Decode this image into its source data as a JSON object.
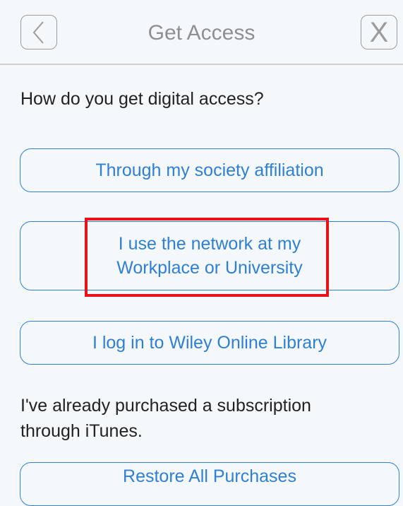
{
  "header": {
    "title": "Get Access",
    "back_icon": "chevron-left-icon",
    "close_label": "X"
  },
  "prompt": "How do you get digital access?",
  "options": {
    "society": "Through my society affiliation",
    "network_line1": "I use the network at my",
    "network_line2": "Workplace or University",
    "wiley": "I log in to Wiley Online Library"
  },
  "purchased_note": {
    "line1": "I've already purchased a subscription",
    "line2": "through iTunes."
  },
  "restore": {
    "label": "Restore All Purchases"
  },
  "colors": {
    "accent": "#2f7fd6",
    "highlight": "#e8131a",
    "background": "#f4f8fb"
  }
}
